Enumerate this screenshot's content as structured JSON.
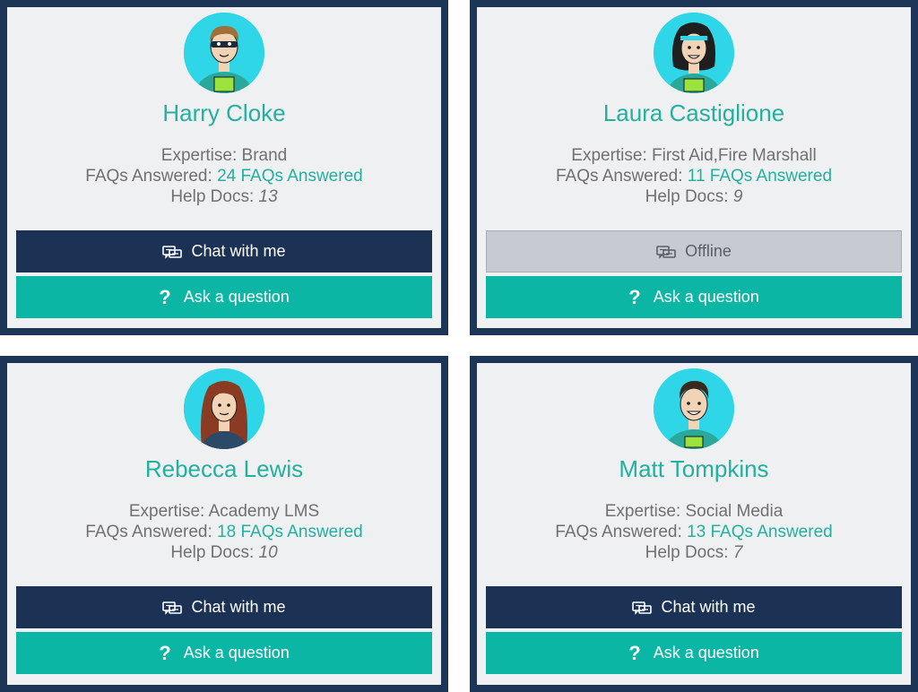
{
  "labels": {
    "expertise": "Expertise: ",
    "faqs": "FAQs Answered: ",
    "help_docs": "Help Docs: ",
    "ask": "Ask a question",
    "question_mark": "?"
  },
  "cards": [
    {
      "name": "Harry Cloke",
      "expertise": "Brand",
      "faqs": "24 FAQs Answered",
      "help_docs": "13",
      "chat_label": "Chat with me"
    },
    {
      "name": "Laura Castiglione",
      "expertise": "First Aid,Fire Marshall",
      "faqs": "11 FAQs Answered",
      "help_docs": "9",
      "chat_label": "Offline"
    },
    {
      "name": "Rebecca Lewis",
      "expertise": "Academy LMS",
      "faqs": "18 FAQs Answered",
      "help_docs": "10",
      "chat_label": "Chat with me"
    },
    {
      "name": "Matt Tompkins",
      "expertise": "Social Media",
      "faqs": "13 FAQs Answered",
      "help_docs": "7",
      "chat_label": "Chat with me"
    }
  ],
  "colors": {
    "border": "#1d3557",
    "accent": "#23b0a1",
    "chat_button": "#1b3254",
    "ask_button": "#0bb6a5",
    "offline_button": "#c7cbd1"
  },
  "icons": {
    "chat": "chat-bubbles-icon",
    "question": "question-mark-icon"
  }
}
